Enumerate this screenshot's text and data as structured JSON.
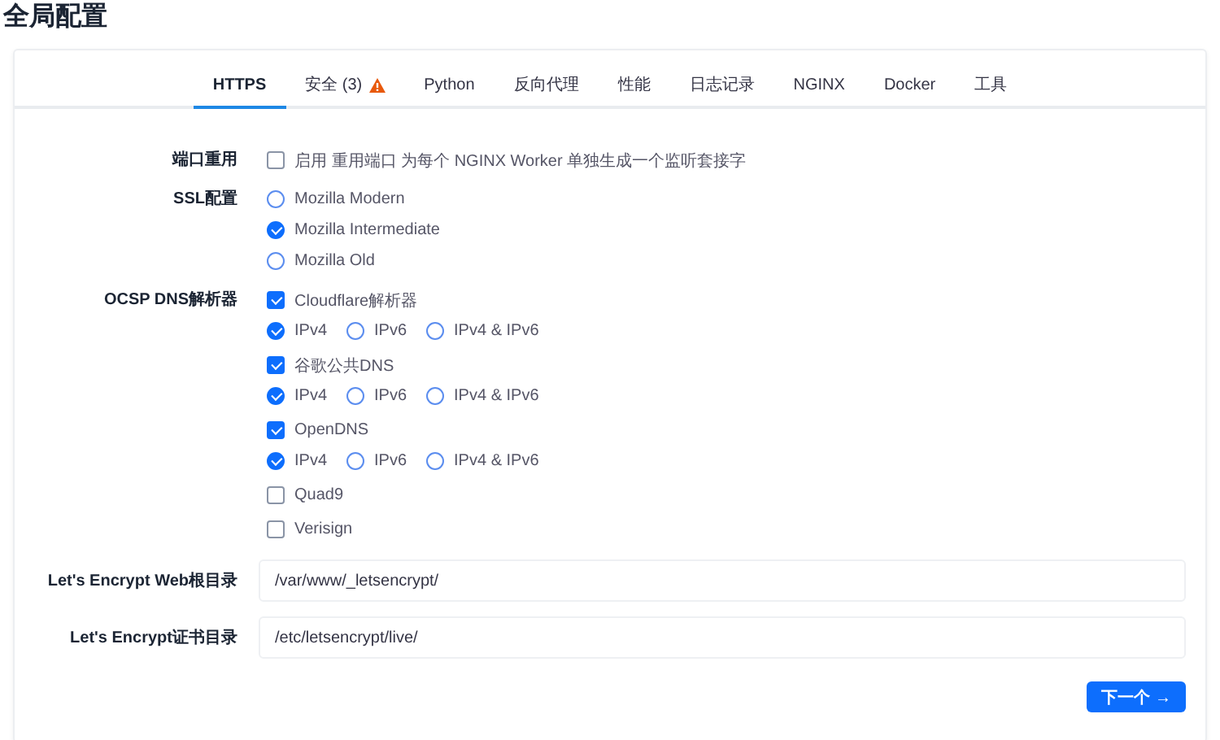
{
  "page_title": "全局配置",
  "tabs": [
    {
      "label": "HTTPS",
      "selected": true,
      "warning": false
    },
    {
      "label": "安全 (3)",
      "selected": false,
      "warning": true
    },
    {
      "label": "Python",
      "selected": false,
      "warning": false
    },
    {
      "label": "反向代理",
      "selected": false,
      "warning": false
    },
    {
      "label": "性能",
      "selected": false,
      "warning": false
    },
    {
      "label": "日志记录",
      "selected": false,
      "warning": false
    },
    {
      "label": "NGINX",
      "selected": false,
      "warning": false
    },
    {
      "label": "Docker",
      "selected": false,
      "warning": false
    },
    {
      "label": "工具",
      "selected": false,
      "warning": false
    }
  ],
  "fields": [
    {
      "kind": "checkbox",
      "label": "端口重用",
      "options": [
        {
          "label": "启用 重用端口 为每个 NGINX Worker 单独生成一个监听套接字",
          "checked": false
        }
      ]
    },
    {
      "kind": "radio",
      "label": "SSL配置",
      "options": [
        {
          "label": "Mozilla Modern",
          "selected": false
        },
        {
          "label": "Mozilla Intermediate",
          "selected": true
        },
        {
          "label": "Mozilla Old",
          "selected": false
        }
      ]
    },
    {
      "kind": "resolvers",
      "label": "OCSP DNS解析器",
      "resolvers": [
        {
          "label": "Cloudflare解析器",
          "checked": true,
          "ip_options": [
            {
              "label": "IPv4",
              "selected": true
            },
            {
              "label": "IPv6",
              "selected": false
            },
            {
              "label": "IPv4 & IPv6",
              "selected": false
            }
          ]
        },
        {
          "label": "谷歌公共DNS",
          "checked": true,
          "ip_options": [
            {
              "label": "IPv4",
              "selected": true
            },
            {
              "label": "IPv6",
              "selected": false
            },
            {
              "label": "IPv4 & IPv6",
              "selected": false
            }
          ]
        },
        {
          "label": "OpenDNS",
          "checked": true,
          "ip_options": [
            {
              "label": "IPv4",
              "selected": true
            },
            {
              "label": "IPv6",
              "selected": false
            },
            {
              "label": "IPv4 & IPv6",
              "selected": false
            }
          ]
        },
        {
          "label": "Quad9",
          "checked": false
        },
        {
          "label": "Verisign",
          "checked": false
        }
      ]
    },
    {
      "kind": "text",
      "label": "Let's Encrypt Web根目录",
      "value": "/var/www/_letsencrypt/"
    },
    {
      "kind": "text",
      "label": "Let's Encrypt证书目录",
      "value": "/etc/letsencrypt/live/"
    }
  ],
  "next_button": "下一个 →"
}
